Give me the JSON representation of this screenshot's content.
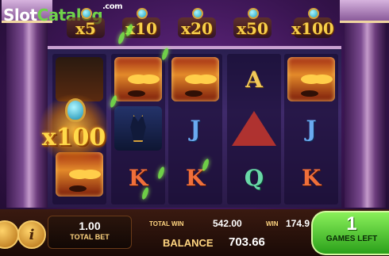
{
  "logo": {
    "slot": "Slot",
    "catalog": "Catalog",
    "com": ".com"
  },
  "multipliers": [
    "x5",
    "x10",
    "x20",
    "x50",
    "x100"
  ],
  "wild": {
    "multiplier": "x100"
  },
  "reels": {
    "col1": [
      "dark",
      "wild",
      "horus"
    ],
    "col2": [
      "horus",
      "anubis",
      "K"
    ],
    "col3": [
      "horus",
      "J",
      "K"
    ],
    "col4": [
      "A",
      "pyramid",
      "Q"
    ],
    "col5": [
      "horus",
      "J",
      "K"
    ]
  },
  "bottom": {
    "total_bet_value": "1.00",
    "total_bet_label": "TOTAL BET",
    "total_win_label": "TOTAL WIN",
    "total_win_value": "542.00",
    "win_label": "WIN",
    "win_value": "174.9",
    "balance_label": "BALANCE",
    "balance_value": "703.66",
    "games_left_count": "1",
    "games_left_label": "GAMES LEFT",
    "info_symbol": "i"
  },
  "colors": {
    "accent": "#f7cf4a",
    "games_left": "#6fd24a",
    "background": "#3a1552"
  }
}
